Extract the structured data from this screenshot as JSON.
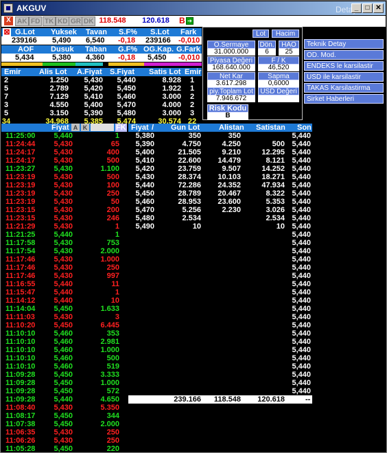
{
  "window": {
    "title": "AKGUV",
    "subtitle": "Detay"
  },
  "toolbar": {
    "close_label": "X",
    "tabs": [
      "AK",
      "FD",
      "TK",
      "KD",
      "GR",
      "DK"
    ],
    "value_red": "118.548",
    "value_blue": "120.618",
    "b_label": "B"
  },
  "summary": {
    "headers": [
      "G.Lot",
      "Yuksek",
      "Tavan",
      "S.F%",
      "S.Lot",
      "Fark"
    ],
    "values": [
      "239166",
      "5,490",
      "6,540",
      "-0,18",
      "239166",
      "-0,010"
    ],
    "headers2": [
      "AOF",
      "Dusuk",
      "Taban",
      "G.F%",
      "OG.Kap.",
      "G.Fark"
    ],
    "values2": [
      "5,434",
      "5,380",
      "4,360",
      "-0,18",
      "5,450",
      "-0,010"
    ]
  },
  "depth": {
    "headers": [
      "Emir",
      "Alis Lot",
      "A.Fiyat",
      "S.Fiyat",
      "Satis Lot",
      "Emir"
    ],
    "rows": [
      [
        "2",
        "1.250",
        "5,430",
        "5,440",
        "8.928",
        "1"
      ],
      [
        "5",
        "2.789",
        "5,420",
        "5,450",
        "1.922",
        "1"
      ],
      [
        "7",
        "7.129",
        "5,410",
        "5,460",
        "3.000",
        "2"
      ],
      [
        "3",
        "4.550",
        "5,400",
        "5,470",
        "4.000",
        "2"
      ],
      [
        "5",
        "3.150",
        "5,390",
        "5,480",
        "3.000",
        "3"
      ]
    ],
    "totals": [
      "34",
      "34.968",
      "5,385",
      "5,474",
      "30.574",
      "22"
    ]
  },
  "panel": {
    "lot_label": "Lot",
    "hacim_label": "Hacim",
    "osermaye_label": "O.Sermaye",
    "osermaye_value": "31.000.000",
    "don_label": "Dön.",
    "don_value": "6",
    "hao_label": "HAO",
    "hao_value": "25",
    "piyasa_label": "Piyasa Değeri",
    "piyasa_value": "168.640.000",
    "fk_label": "F / K",
    "fk_value": "46,520",
    "netkar_label": "Net Kar",
    "netkar_value": "3.617.298",
    "sapma_label": "Sapma",
    "sapma_value": "0,6000",
    "pytoplam_label": "piy.Toplam Lot",
    "pytoplam_value": "7.946.672",
    "usd_label": "USD Değeri",
    "risk_label": "Risk Kodu",
    "risk_value": "B"
  },
  "side_buttons": [
    "Teknik Detay",
    "OD. Mod.",
    "ENDEKS le karsilastir",
    "USD ile karsilastir",
    "TAKAS Karsilastirma",
    "Sirket Haberleri"
  ],
  "trades_header": {
    "fiyat": "Fiyat",
    "fk": "FK"
  },
  "trades": [
    [
      "11:25:00",
      "5,440",
      "1",
      "g"
    ],
    [
      "11:24:44",
      "5,430",
      "65",
      "r"
    ],
    [
      "11:24:17",
      "5,430",
      "400",
      "r"
    ],
    [
      "11:24:17",
      "5,430",
      "500",
      "r"
    ],
    [
      "11:23:27",
      "5,430",
      "1.100",
      "g"
    ],
    [
      "11:23:19",
      "5,430",
      "500",
      "r"
    ],
    [
      "11:23:19",
      "5,430",
      "100",
      "r"
    ],
    [
      "11:23:19",
      "5,430",
      "250",
      "r"
    ],
    [
      "11:23:19",
      "5,430",
      "50",
      "r"
    ],
    [
      "11:23:15",
      "5,430",
      "200",
      "r"
    ],
    [
      "11:23:15",
      "5,430",
      "246",
      "r"
    ],
    [
      "11:21:29",
      "5,430",
      "1",
      "r"
    ],
    [
      "11:21:25",
      "5,440",
      "1",
      "g"
    ],
    [
      "11:17:58",
      "5,430",
      "753",
      "g"
    ],
    [
      "11:17:54",
      "5,430",
      "2.000",
      "g"
    ],
    [
      "11:17:46",
      "5,430",
      "1.000",
      "r"
    ],
    [
      "11:17:46",
      "5,430",
      "250",
      "r"
    ],
    [
      "11:17:46",
      "5,430",
      "997",
      "r"
    ],
    [
      "11:16:55",
      "5,440",
      "11",
      "r"
    ],
    [
      "11:15:47",
      "5,440",
      "1",
      "r"
    ],
    [
      "11:14:12",
      "5,440",
      "10",
      "r"
    ],
    [
      "11:14:04",
      "5,450",
      "1.633",
      "g"
    ],
    [
      "11:11:03",
      "5,430",
      "3",
      "r"
    ],
    [
      "11:10:20",
      "5,450",
      "6.445",
      "r"
    ],
    [
      "11:10:10",
      "5,460",
      "353",
      "g"
    ],
    [
      "11:10:10",
      "5,460",
      "2.981",
      "g"
    ],
    [
      "11:10:10",
      "5,460",
      "1.000",
      "g"
    ],
    [
      "11:10:10",
      "5,460",
      "500",
      "g"
    ],
    [
      "11:10:10",
      "5,460",
      "519",
      "g"
    ],
    [
      "11:09:28",
      "5,450",
      "3.333",
      "g"
    ],
    [
      "11:09:28",
      "5,450",
      "1.000",
      "g"
    ],
    [
      "11:09:28",
      "5,450",
      "572",
      "g"
    ],
    [
      "11:09:28",
      "5,440",
      "4.650",
      "g"
    ],
    [
      "11:08:40",
      "5,430",
      "5.350",
      "r"
    ],
    [
      "11:08:17",
      "5,450",
      "344",
      "g"
    ],
    [
      "11:07:38",
      "5,450",
      "2.000",
      "g"
    ],
    [
      "11:06:35",
      "5,430",
      "250",
      "r"
    ],
    [
      "11:06:26",
      "5,430",
      "250",
      "r"
    ],
    [
      "11:05:28",
      "5,450",
      "220",
      "g"
    ]
  ],
  "volume": {
    "headers": [
      "Fiyat",
      "Gun Lot",
      "Alistan",
      "Satistan",
      "Son"
    ],
    "rows": [
      [
        "5,380",
        "350",
        "350",
        "",
        "5,440"
      ],
      [
        "5,390",
        "4.750",
        "4.250",
        "500",
        "5,440"
      ],
      [
        "5,400",
        "21.505",
        "9.210",
        "12.295",
        "5,440"
      ],
      [
        "5,410",
        "22.600",
        "14.479",
        "8.121",
        "5,440"
      ],
      [
        "5,420",
        "23.759",
        "9.507",
        "14.252",
        "5,440"
      ],
      [
        "5,430",
        "28.374",
        "10.103",
        "18.271",
        "5,440"
      ],
      [
        "5,440",
        "72.286",
        "24.352",
        "47.934",
        "5,440"
      ],
      [
        "5,450",
        "28.789",
        "20.467",
        "8.322",
        "5,440"
      ],
      [
        "5,460",
        "28.953",
        "23.600",
        "5.353",
        "5,440"
      ],
      [
        "5,470",
        "5.256",
        "2.230",
        "3.026",
        "5,440"
      ],
      [
        "5,480",
        "2.534",
        "",
        "2.534",
        "5,440"
      ],
      [
        "5,490",
        "10",
        "",
        "10",
        "5,440"
      ]
    ],
    "son_extra": [
      "5,440",
      "5,440",
      "5,440",
      "5,440",
      "5,440",
      "5,440",
      "5,440",
      "5,440",
      "5,440",
      "5,440",
      "5,440",
      "5,440",
      "5,440",
      "5,440",
      "5,440",
      "5,440",
      "5,440",
      "5,440",
      "5,440",
      "5,440",
      "5,440",
      "5,440",
      "5,440",
      "5,440",
      "5,440",
      "5,440",
      "5,440",
      "5,440",
      "5,440",
      "5,440",
      "5,440",
      "5,440",
      "5,440"
    ],
    "totals": [
      "239.166",
      "118.548",
      "120.618",
      "--"
    ]
  },
  "colors": {
    "header_blue": "#1e7ad6",
    "button_blue": "#5a7ad8",
    "up": "#20e020",
    "down": "#ff2020"
  }
}
